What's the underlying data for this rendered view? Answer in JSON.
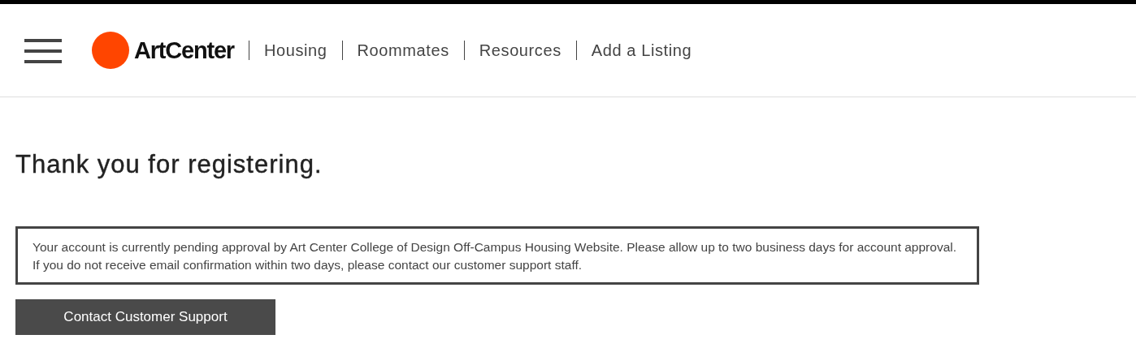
{
  "header": {
    "logo": "ArtCenter",
    "nav": [
      "Housing",
      "Roommates",
      "Resources",
      "Add a Listing"
    ]
  },
  "heading": "Thank you for registering.",
  "message": "Your account is currently pending approval by Art Center College of Design Off-Campus Housing Website. Please allow up to two business days for account approval. If you do not receive email confirmation within two days, please contact our customer support staff.",
  "button": "Contact Customer Support"
}
